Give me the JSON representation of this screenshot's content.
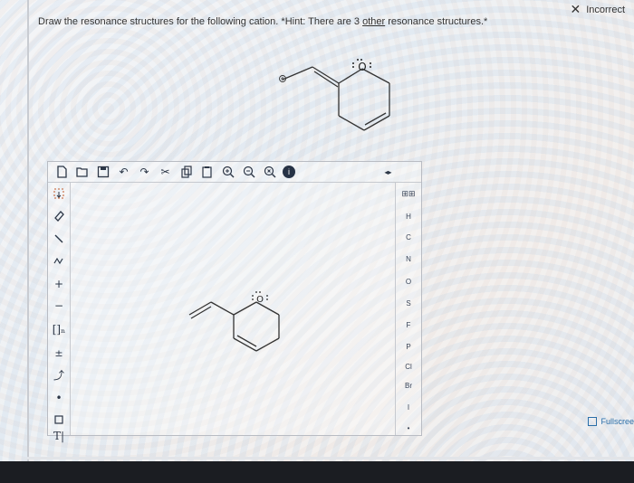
{
  "status": {
    "label": "Incorrect",
    "icon": "x-icon"
  },
  "question": {
    "text_before": "Draw the resonance structures for the following cation.  *Hint: There are 3 ",
    "underlined": "other",
    "text_after": " resonance structures.*"
  },
  "molecule": {
    "charge_symbol": "⊕",
    "oxygen_label": "O"
  },
  "toolbar_top": [
    "new-icon",
    "open-icon",
    "save-icon",
    "undo-icon",
    "redo-icon",
    "cut-icon",
    "copy-icon",
    "paste-icon",
    "zoom-in-icon",
    "zoom-out-icon",
    "zoom-reset-icon",
    "info-icon"
  ],
  "toolbar_left": [
    "select-icon",
    "erase-icon",
    "single-bond-icon",
    "chain-icon",
    "positive-charge-icon",
    "negative-charge-icon",
    "bracket-icon",
    "plus-minus-icon",
    "arrow-icon",
    "electron-dot-icon",
    "rectangle-icon",
    "text-icon"
  ],
  "periodic_label": "periodic-table",
  "elements": [
    "H",
    "C",
    "N",
    "O",
    "S",
    "F",
    "P",
    "Cl",
    "Br",
    "I"
  ],
  "expand_arrows": "◂▸",
  "text_tool": "T|",
  "fullscreen_label": "Fullscree",
  "colors": {
    "accent": "#2a6ea8",
    "toolbar_icon": "#2c3646"
  }
}
